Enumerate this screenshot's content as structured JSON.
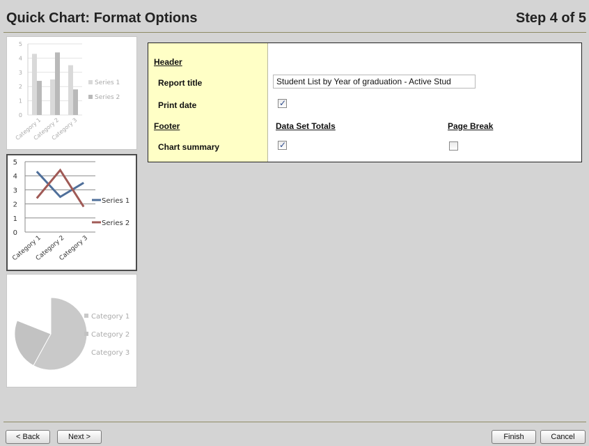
{
  "header": {
    "title": "Quick Chart: Format Options",
    "step": "Step 4 of 5"
  },
  "chart_data": [
    {
      "type": "bar",
      "categories": [
        "Category 1",
        "Category 2",
        "Category 3"
      ],
      "series": [
        {
          "name": "Series 1",
          "values": [
            4.3,
            2.5,
            3.5
          ]
        },
        {
          "name": "Series 2",
          "values": [
            2.4,
            4.4,
            1.8
          ]
        }
      ],
      "ylim": [
        0,
        5
      ],
      "yticks": [
        "0",
        "1",
        "2",
        "3",
        "4",
        "5"
      ],
      "legend": "right",
      "colors": [
        "#d9d9d9",
        "#b9b9b9"
      ]
    },
    {
      "type": "line",
      "categories": [
        "Category 1",
        "Category 2",
        "Category 3"
      ],
      "series": [
        {
          "name": "Series 1",
          "values": [
            4.3,
            2.5,
            3.5
          ]
        },
        {
          "name": "Series 2",
          "values": [
            2.4,
            4.4,
            1.8
          ]
        }
      ],
      "ylim": [
        0,
        5
      ],
      "yticks": [
        "0",
        "1",
        "2",
        "3",
        "4",
        "5"
      ],
      "legend": "right",
      "colors": [
        "#4f6f9a",
        "#a05a56"
      ]
    },
    {
      "type": "pie",
      "categories": [
        "Category 1",
        "Category 2",
        "Category 3"
      ],
      "values": [
        58,
        23,
        19
      ],
      "legend": "right",
      "colors": [
        "#c9c9c9",
        "#c2c2c2",
        "#ffffff"
      ]
    }
  ],
  "options": {
    "header_label": "Header",
    "report_title_label": "Report title",
    "report_title_value": "Student List by Year of graduation - Active Stud",
    "print_date_label": "Print date",
    "print_date_checked": true,
    "footer_label": "Footer",
    "data_set_totals_label": "Data Set Totals",
    "page_break_label": "Page Break",
    "chart_summary_label": "Chart summary",
    "chart_summary_totals_checked": true,
    "chart_summary_pagebreak_checked": false
  },
  "buttons": {
    "back": "< Back",
    "next": "Next >",
    "finish": "Finish",
    "cancel": "Cancel"
  }
}
